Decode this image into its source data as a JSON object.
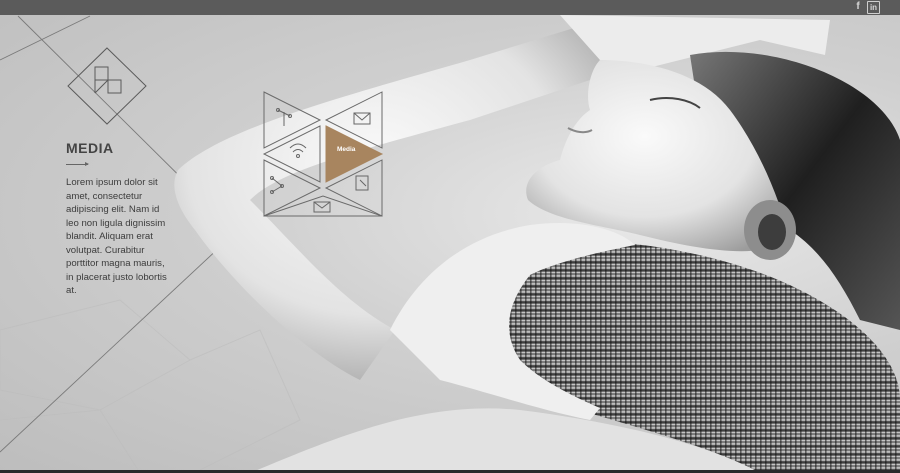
{
  "header": {
    "social": [
      {
        "name": "facebook-icon",
        "glyph": "f"
      },
      {
        "name": "linkedin-icon",
        "glyph": "in"
      }
    ]
  },
  "section": {
    "title": "MEDIA",
    "body": "Lorem ipsum dolor sit amet, consectetur adipiscing elit. Nam id leo non ligula dignissim blandit. Aliquam erat volutpat. Curabitur porttitor magna mauris, in placerat justo lobortis at."
  },
  "menu": {
    "active_label": "Media",
    "accent_color": "#a8855f",
    "items": [
      "network-icon",
      "mail-icon",
      "wifi-icon",
      "media",
      "share-icon",
      "edit-icon",
      "envelope-icon"
    ]
  },
  "colors": {
    "topbar": "#5b5b5b",
    "background": "#cfcfcf"
  }
}
